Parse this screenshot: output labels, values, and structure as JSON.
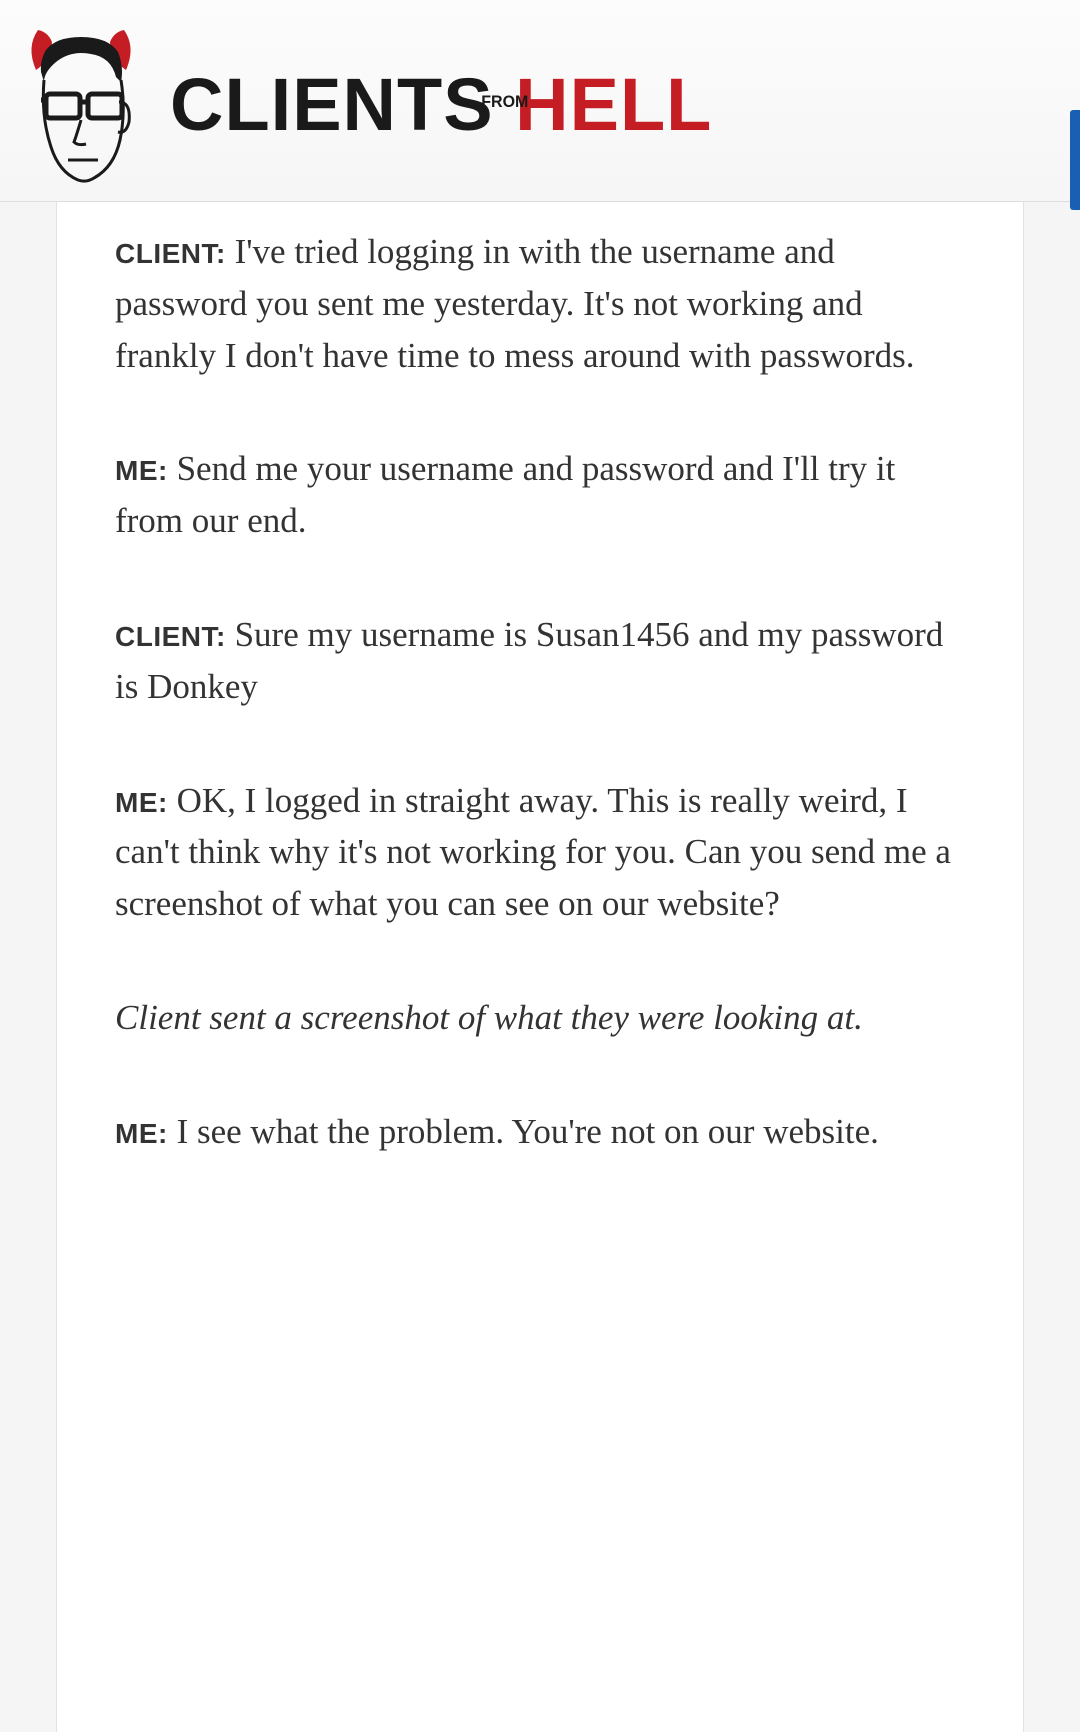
{
  "brand": {
    "clients": "CLIENTS",
    "from_top": "FR",
    "from_bot": "OM",
    "hell": "HELL"
  },
  "dialogue": [
    {
      "speaker": "CLIENT:",
      "text": " I've tried logging in with the username and password you sent me yesterday. It's not working and frankly I don't have time to mess around with passwords.",
      "italic": false
    },
    {
      "speaker": "ME:",
      "text": " Send me your username and password and I'll try it from our end.",
      "italic": false
    },
    {
      "speaker": "CLIENT:",
      "text": " Sure my username is Susan1456 and my password is Donkey",
      "italic": false
    },
    {
      "speaker": "ME:",
      "text": " OK, I logged in straight away. This is really weird, I can't think why it's not working for you. Can you send me a screenshot of what you can see on our website?",
      "italic": false
    },
    {
      "speaker": "",
      "text": "Client sent a screenshot of what they were looking at.",
      "italic": true
    },
    {
      "speaker": "ME:",
      "text": " I see what the problem. You're not on our website.",
      "italic": false
    }
  ]
}
